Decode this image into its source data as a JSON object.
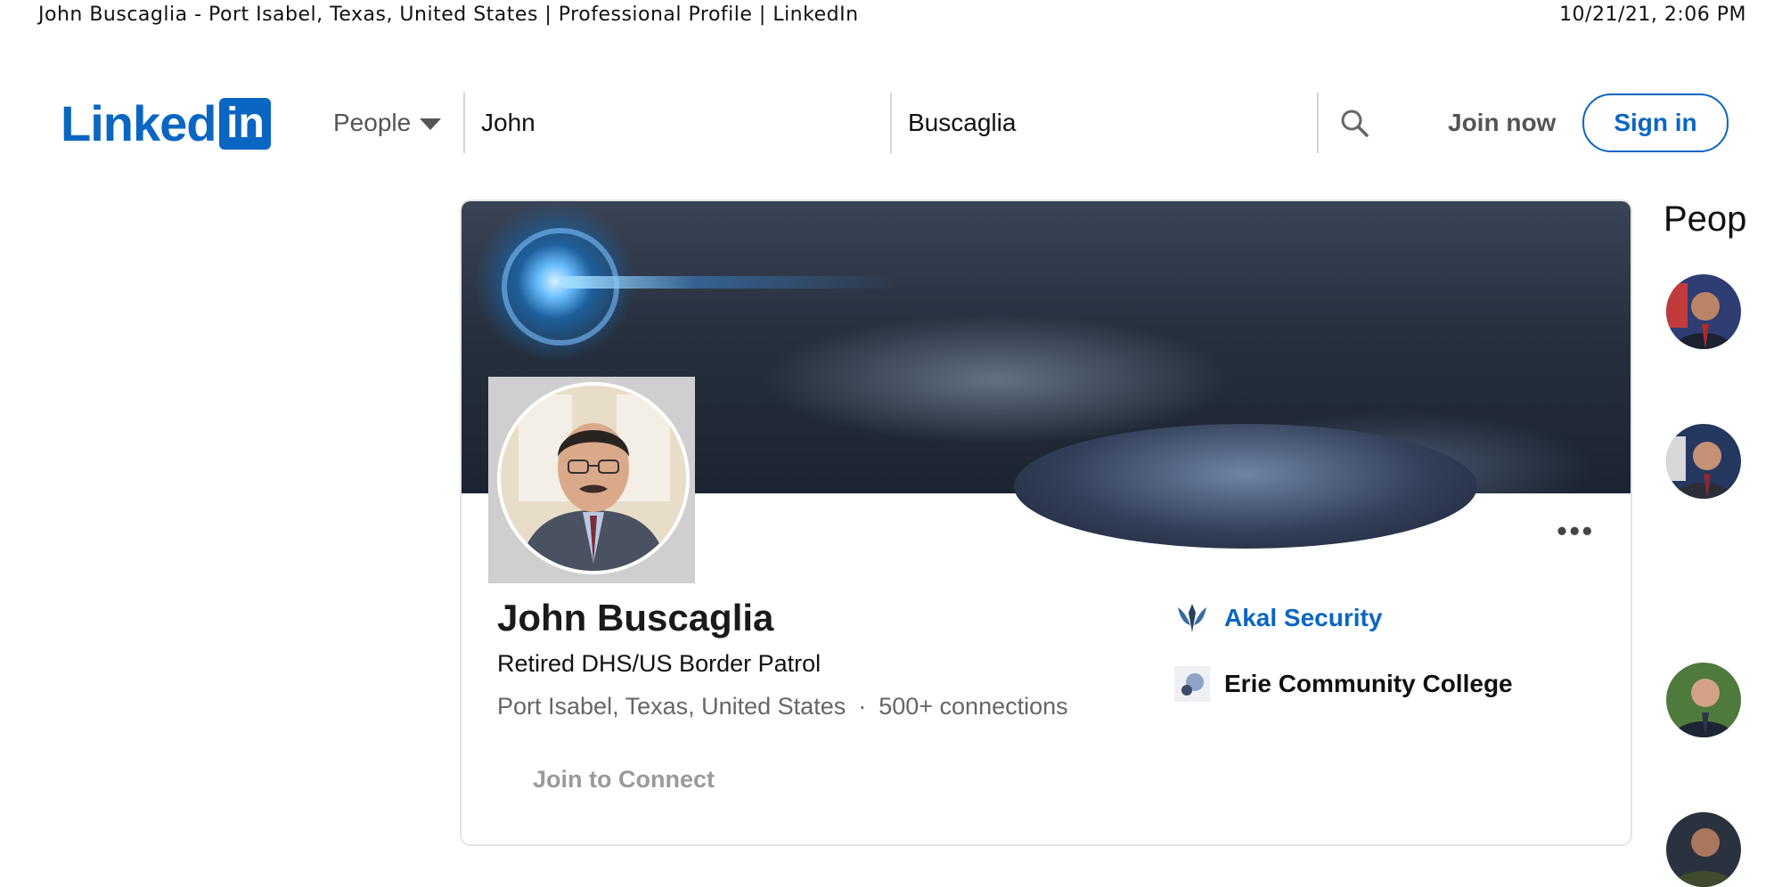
{
  "print_header": {
    "title": "John Buscaglia - Port Isabel, Texas, United States | Professional Profile | LinkedIn",
    "timestamp": "10/21/21, 2:06 PM"
  },
  "nav": {
    "logo_word": "Linked",
    "logo_box": "in",
    "people_dropdown": "People",
    "first_name_value": "John",
    "last_name_value": "Buscaglia",
    "join_now": "Join now",
    "sign_in": "Sign in"
  },
  "profile": {
    "name": "John Buscaglia",
    "headline": "Retired DHS/US Border Patrol",
    "location": "Port Isabel, Texas, United States",
    "separator": "·",
    "connections": "500+ connections",
    "join_to_connect": "Join to Connect",
    "more_menu": "•••",
    "experience": {
      "company": "Akal Security"
    },
    "education": {
      "school": "Erie Community College"
    }
  },
  "sidebar": {
    "title_fragment": "Peop"
  },
  "colors": {
    "brand": "#0a66c2",
    "muted_text": "#666666"
  },
  "icons": [
    "search-icon",
    "chevron-down-icon",
    "more-icon",
    "akal-security-logo",
    "erie-college-logo"
  ]
}
